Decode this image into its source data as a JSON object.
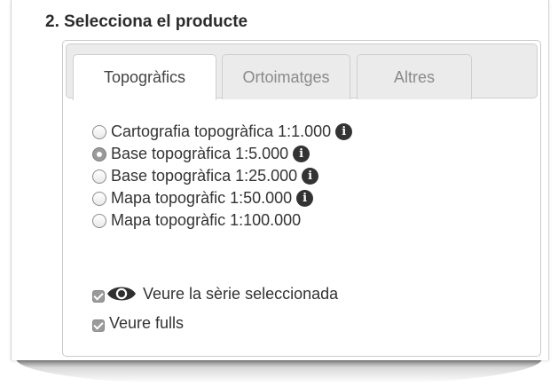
{
  "section": {
    "title": "2. Selecciona el producte"
  },
  "tabs": [
    {
      "label": "Topogràfics",
      "active": true
    },
    {
      "label": "Ortoimatges",
      "active": false
    },
    {
      "label": "Altres",
      "active": false
    }
  ],
  "products": [
    {
      "label": "Cartografia topogràfica 1:1.000",
      "selected": false,
      "info_icon": true
    },
    {
      "label": "Base topogràfica 1:5.000",
      "selected": true,
      "info_icon": true
    },
    {
      "label": "Base topogràfica 1:25.000",
      "selected": false,
      "info_icon": true
    },
    {
      "label": "Mapa topogràfic 1:50.000",
      "selected": false,
      "info_icon": true
    },
    {
      "label": "Mapa topogràfic 1:100.000",
      "selected": false,
      "info_icon": false
    }
  ],
  "info_icon_glyph": "i",
  "options": {
    "view_series": {
      "label": "Veure la sèrie seleccionada",
      "checked": true,
      "icon": "eye-icon"
    },
    "view_sheets": {
      "label": "Veure fulls",
      "checked": true
    }
  },
  "colors": {
    "checked_control": "#9a9a9a",
    "tab_inactive_bg": "#ebebeb",
    "text": "#333333"
  }
}
